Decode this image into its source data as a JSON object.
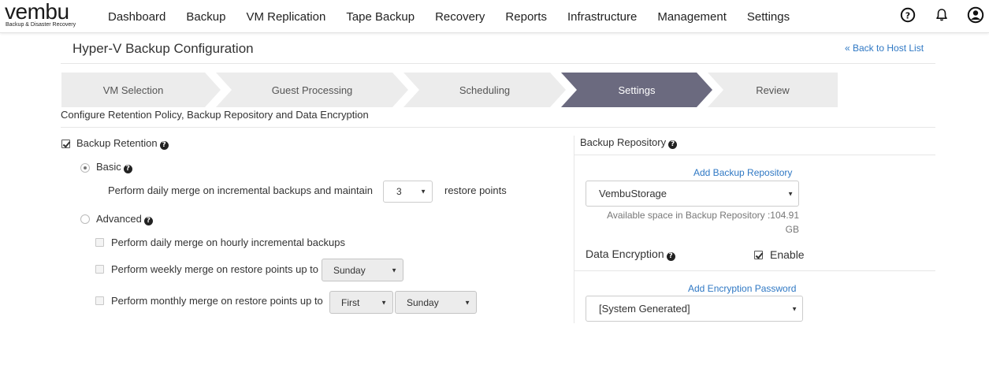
{
  "brand": {
    "name": "vembu",
    "tagline": "Backup & Disaster Recovery"
  },
  "nav": {
    "items": [
      "Dashboard",
      "Backup",
      "VM Replication",
      "Tape Backup",
      "Recovery",
      "Reports",
      "Infrastructure",
      "Management",
      "Settings"
    ],
    "icons": [
      "help-circle-icon",
      "bell-icon",
      "user-account-icon"
    ]
  },
  "page": {
    "title": "Hyper-V Backup Configuration",
    "back_link": "« Back to Host List",
    "subtitle": "Configure Retention Policy, Backup Repository and Data Encryption"
  },
  "wizard": {
    "steps": [
      "VM Selection",
      "Guest Processing",
      "Scheduling",
      "Settings",
      "Review"
    ],
    "active_index": 3,
    "active_color": "#6b6a7f",
    "inactive_color": "#ececec"
  },
  "retention": {
    "label": "Backup Retention",
    "checked": true,
    "basic": {
      "label": "Basic",
      "selected": true,
      "merge_text": "Perform daily merge on incremental backups and maintain",
      "restore_points_value": "3",
      "suffix": "restore points"
    },
    "advanced": {
      "label": "Advanced",
      "selected": false,
      "hourly_text": "Perform daily merge on hourly incremental backups",
      "weekly_text": "Perform weekly merge on restore points up to",
      "weekly_day": "Sunday",
      "monthly_text": "Perform monthly merge on restore points up to",
      "monthly_week": "First",
      "monthly_day": "Sunday"
    }
  },
  "repository": {
    "title": "Backup Repository",
    "add_link": "Add Backup Repository",
    "selected": "VembuStorage",
    "available_line1": "Available space in Backup Repository :104.91",
    "available_line2": "GB"
  },
  "encryption": {
    "title": "Data Encryption",
    "enable_label": "Enable",
    "enabled": true,
    "add_link": "Add Encryption Password",
    "selected": "[System Generated]"
  }
}
